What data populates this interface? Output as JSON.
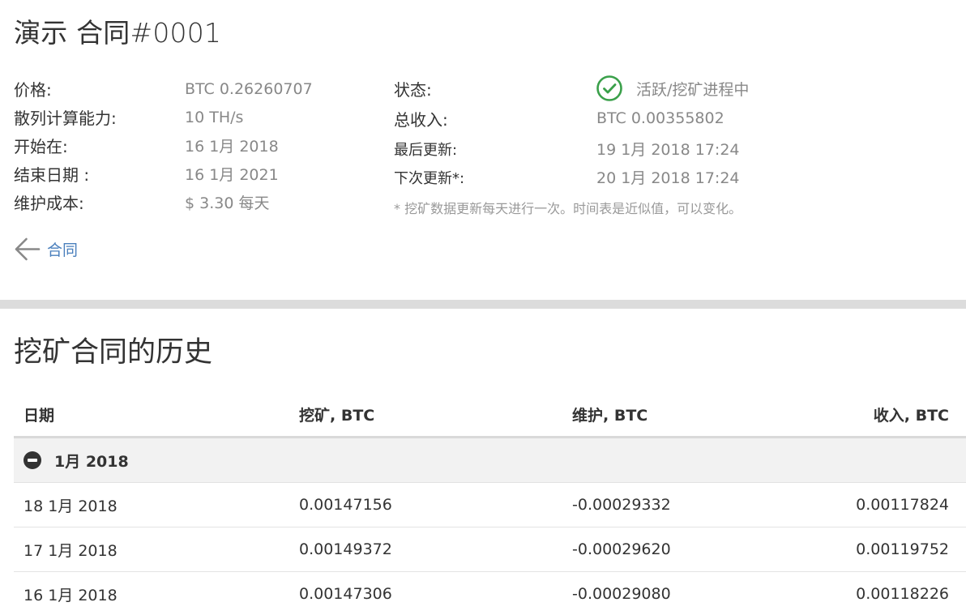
{
  "contract": {
    "title": "演示 合同#0001",
    "left": [
      {
        "label": "价格:",
        "value": "BTC 0.26260707"
      },
      {
        "label": "散列计算能力:",
        "value": "10 TH/s"
      },
      {
        "label": "开始在:",
        "value": "16 1月 2018"
      },
      {
        "label": "结束日期 :",
        "value": "16 1月 2021"
      },
      {
        "label": "维护成本:",
        "value": "$ 3.30 每天"
      }
    ],
    "status_label": "状态:",
    "status_value": "活跃/挖矿进程中",
    "income_label": "总收入:",
    "income_value": "BTC 0.00355802",
    "last_update_label": "最后更新:",
    "last_update_value": "19 1月 2018 17:24",
    "next_update_label": "下次更新*:",
    "next_update_value": "20 1月 2018 17:24",
    "note": "* 挖矿数据更新每天进行一次。时间表是近似值，可以变化。",
    "back_link": "合同",
    "status_color": "#3aa04a",
    "link_color": "#4a7fbc"
  },
  "history": {
    "title": "挖矿合同的历史",
    "columns": [
      "日期",
      "挖矿, BTC",
      "维护, BTC",
      "收入, BTC"
    ],
    "groups": [
      {
        "label": "1月 2018",
        "rows": [
          [
            "18 1月 2018",
            "0.00147156",
            "-0.00029332",
            "0.00117824"
          ],
          [
            "17 1月 2018",
            "0.00149372",
            "-0.00029620",
            "0.00119752"
          ],
          [
            "16 1月 2018",
            "0.00147306",
            "-0.00029080",
            "0.00118226"
          ]
        ]
      }
    ]
  },
  "icons": {
    "status": "check-circle-icon",
    "back": "arrow-left-icon",
    "collapse": "minus-circle-icon"
  }
}
